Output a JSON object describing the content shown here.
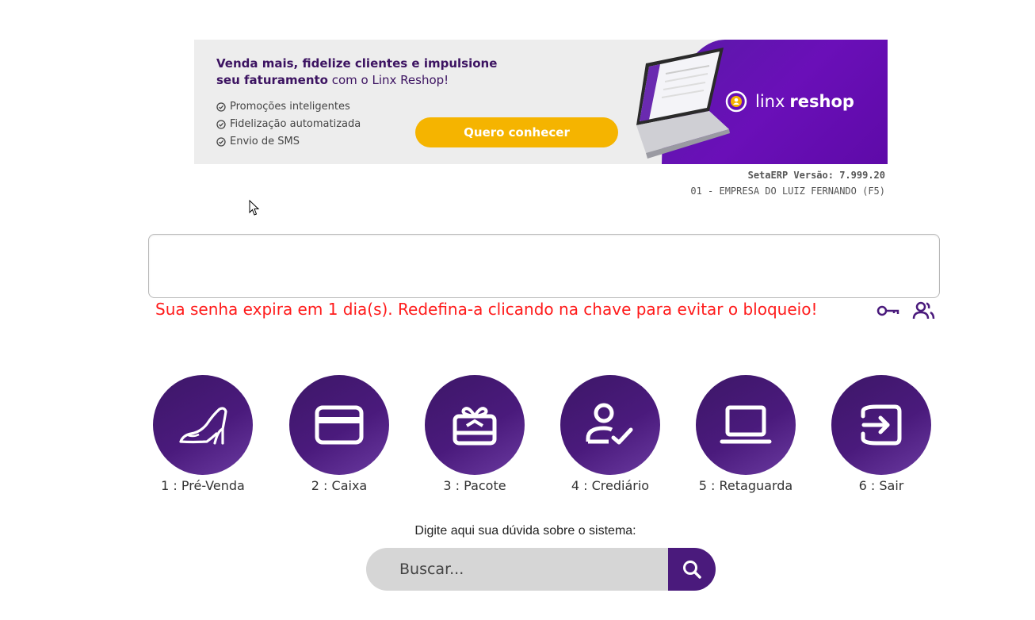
{
  "banner": {
    "headline_bold_1": "Venda mais, fidelize clientes e impulsione",
    "headline_bold_2": "seu faturamento",
    "headline_rest": " com o Linx Reshop!",
    "features": [
      "Promoções inteligentes",
      "Fidelização automatizada",
      "Envio de SMS"
    ],
    "cta_label": "Quero conhecer",
    "brand_prefix": "linx",
    "brand_name": "reshop",
    "colors": {
      "purple": "#6a0fb8",
      "cta": "#f5b400"
    }
  },
  "system": {
    "version": "SetaERP Versão: 7.999.20",
    "company": "01 - EMPRESA DO LUIZ FERNANDO (F5)"
  },
  "warning": {
    "text": "Sua senha expira em 1 dia(s). Redefina-a clicando na chave para evitar o bloqueio!",
    "color": "#ff1a1a"
  },
  "menu": [
    {
      "label": "1 : Pré-Venda",
      "icon": "high-heel-shoe-icon"
    },
    {
      "label": "2 : Caixa",
      "icon": "credit-card-icon"
    },
    {
      "label": "3 : Pacote",
      "icon": "gift-card-icon"
    },
    {
      "label": "4 : Crediário",
      "icon": "user-check-icon"
    },
    {
      "label": "5 : Retaguarda",
      "icon": "laptop-icon"
    },
    {
      "label": "6 : Sair",
      "icon": "exit-icon"
    }
  ],
  "help": {
    "label": "Digite aqui sua dúvida sobre o sistema:",
    "placeholder": "Buscar...",
    "button_icon": "search-icon"
  },
  "accent": "#4a1a7c"
}
